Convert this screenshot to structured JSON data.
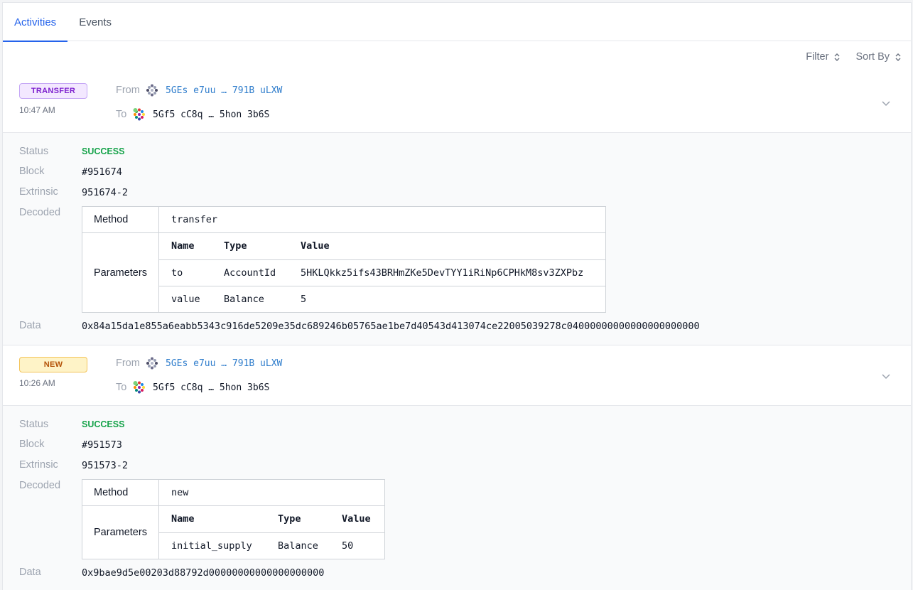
{
  "tabs": [
    {
      "label": "Activities",
      "active": true
    },
    {
      "label": "Events",
      "active": false
    }
  ],
  "toolbar": {
    "filter_label": "Filter",
    "sort_label": "Sort By"
  },
  "colors": {
    "accent": "#2563eb",
    "success": "#16a34a",
    "link": "#2f7dcc"
  },
  "labels": {
    "from": "From",
    "to": "To",
    "status": "Status",
    "block": "Block",
    "extrinsic": "Extrinsic",
    "decoded": "Decoded",
    "data": "Data",
    "method": "Method",
    "parameters": "Parameters",
    "col_name": "Name",
    "col_type": "Type",
    "col_value": "Value"
  },
  "activities": [
    {
      "badge": "TRANSFER",
      "time": "10:47 AM",
      "from": "5GEs e7uu … 791B uLXW",
      "to": "5Gf5 cC8q … 5hon 3b6S",
      "status": "SUCCESS",
      "block": "#951674",
      "extrinsic": "951674-2",
      "method": "transfer",
      "params": [
        {
          "name": "to",
          "type": "AccountId",
          "value": "5HKLQkkz5ifs43BRHmZKe5DevTYY1iRiNp6CPHkM8sv3ZXPbz"
        },
        {
          "name": "value",
          "type": "Balance",
          "value": "5"
        }
      ],
      "data": "0x84a15da1e855a6eabb5343c916de5209e35dc689246b05765ae1be7d40543d413074ce22005039278c04000000000000000000000"
    },
    {
      "badge": "NEW",
      "time": "10:26 AM",
      "from": "5GEs e7uu … 791B uLXW",
      "to": "5Gf5 cC8q … 5hon 3b6S",
      "status": "SUCCESS",
      "block": "#951573",
      "extrinsic": "951573-2",
      "method": "new",
      "params": [
        {
          "name": "initial_supply",
          "type": "Balance",
          "value": "50"
        }
      ],
      "data": "0x9bae9d5e00203d88792d00000000000000000000"
    }
  ]
}
